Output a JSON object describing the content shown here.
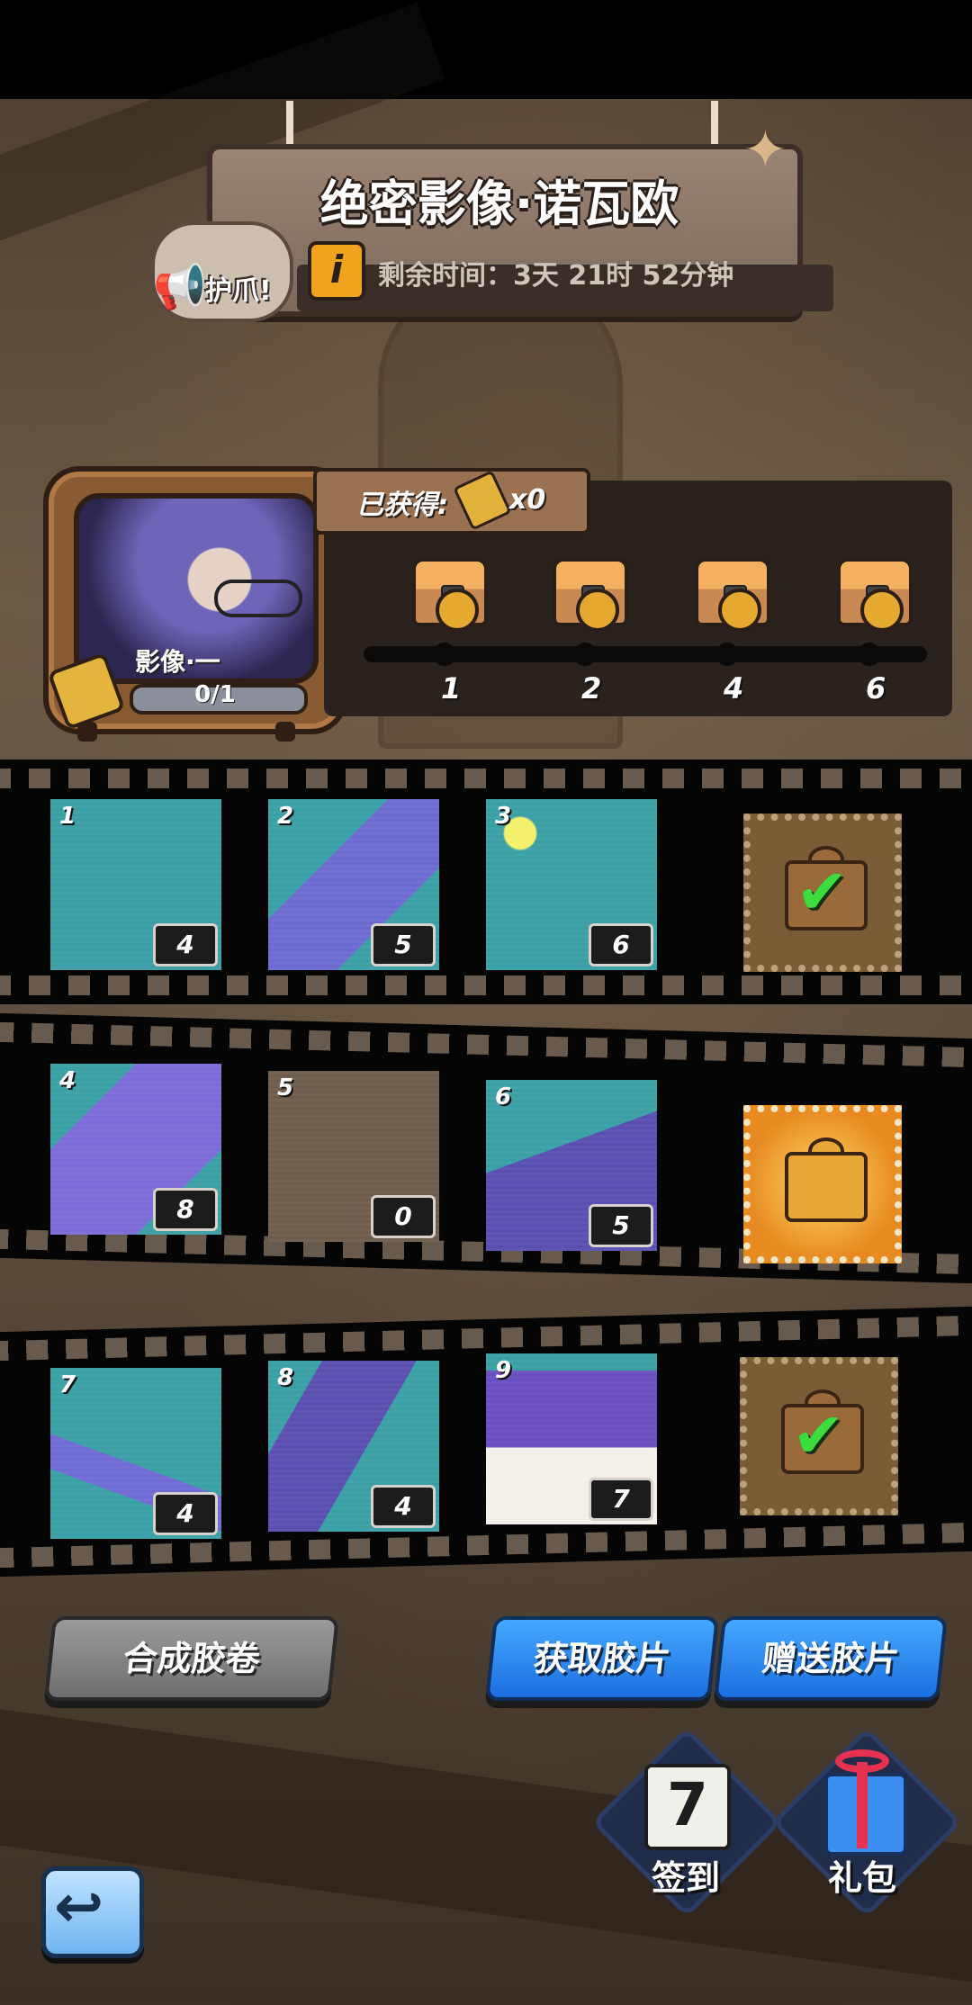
{
  "header": {
    "title": "绝密影像·诺瓦欧",
    "timer_text": "剩余时间：3天 21时 52分钟",
    "mascot_text": "护爪!"
  },
  "preview": {
    "label": "影像·一",
    "progress_text": "0/1",
    "progress_value": 0
  },
  "obtained": {
    "label": "已获得:",
    "count": "x0"
  },
  "milestones": [
    {
      "number": "1"
    },
    {
      "number": "2"
    },
    {
      "number": "4"
    },
    {
      "number": "6"
    }
  ],
  "rows": [
    {
      "tiles": [
        {
          "index": "1",
          "count": "4"
        },
        {
          "index": "2",
          "count": "5"
        },
        {
          "index": "3",
          "count": "6"
        }
      ],
      "reward_state": "claimed"
    },
    {
      "tiles": [
        {
          "index": "4",
          "count": "8"
        },
        {
          "index": "5",
          "count": "0"
        },
        {
          "index": "6",
          "count": "5"
        }
      ],
      "reward_state": "available"
    },
    {
      "tiles": [
        {
          "index": "7",
          "count": "4"
        },
        {
          "index": "8",
          "count": "4"
        },
        {
          "index": "9",
          "count": "7"
        }
      ],
      "reward_state": "claimed"
    }
  ],
  "buttons": {
    "compose": "合成胶卷",
    "get_film": "获取胶片",
    "gift_film": "赠送胶片"
  },
  "side_menu": {
    "checkin_label": "签到",
    "checkin_day": "7",
    "giftpack_label": "礼包"
  },
  "colors": {
    "accent_blue": "#1c6fe0",
    "reward_gold": "#e6a734",
    "check_green": "#3cdc3c"
  }
}
